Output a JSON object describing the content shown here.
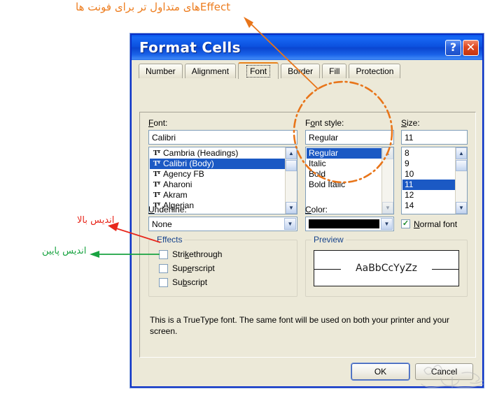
{
  "dialog": {
    "title": "Format Cells",
    "caption_buttons": [
      {
        "name": "help-button",
        "glyph": "?"
      },
      {
        "name": "close-button",
        "glyph": "✕"
      }
    ],
    "tabs": [
      {
        "label": "Number",
        "active": false
      },
      {
        "label": "Alignment",
        "active": false
      },
      {
        "label": "Font",
        "active": true
      },
      {
        "label": "Border",
        "active": false
      },
      {
        "label": "Fill",
        "active": false
      },
      {
        "label": "Protection",
        "active": false
      }
    ]
  },
  "font_column": {
    "label": "Font:",
    "value": "Calibri",
    "items": [
      {
        "label": "Cambria (Headings)",
        "truetype": true,
        "selected": false
      },
      {
        "label": "Calibri (Body)",
        "truetype": true,
        "selected": true
      },
      {
        "label": "Agency FB",
        "truetype": true,
        "selected": false
      },
      {
        "label": "Aharoni",
        "truetype": true,
        "selected": false
      },
      {
        "label": "Akram",
        "truetype": true,
        "selected": false
      },
      {
        "label": "Algerian",
        "truetype": true,
        "selected": false
      }
    ]
  },
  "style_column": {
    "label": "Font style:",
    "value": "Regular",
    "items": [
      {
        "label": "Regular",
        "selected": true
      },
      {
        "label": "Italic",
        "selected": false
      },
      {
        "label": "Bold",
        "selected": false
      },
      {
        "label": "Bold Italic",
        "selected": false
      }
    ]
  },
  "size_column": {
    "label": "Size:",
    "value": "11",
    "items": [
      {
        "label": "8",
        "selected": false
      },
      {
        "label": "9",
        "selected": false
      },
      {
        "label": "10",
        "selected": false
      },
      {
        "label": "11",
        "selected": true
      },
      {
        "label": "12",
        "selected": false
      },
      {
        "label": "14",
        "selected": false
      }
    ]
  },
  "underline": {
    "label": "Underline:",
    "value": "None"
  },
  "color": {
    "label": "Color:",
    "swatch_hex": "#000000",
    "normal_font_label": "Normal font",
    "normal_font_checked": true
  },
  "effects": {
    "title": "Effects",
    "items": [
      {
        "label": "Strikethrough",
        "checked": false
      },
      {
        "label": "Superscript",
        "checked": false
      },
      {
        "label": "Subscript",
        "checked": false
      }
    ]
  },
  "preview": {
    "title": "Preview",
    "sample_text": "AaBbCcYyZz"
  },
  "description": "This is a TrueType font.  The same font will be used on both your printer and your screen.",
  "footer": {
    "ok_label": "OK",
    "cancel_label": "Cancel"
  },
  "annotations": {
    "top": {
      "text": "Effectهای متداول تر برای فونت ها",
      "color": "#ED7D1F"
    },
    "superscript": {
      "text": "اندیس بالا",
      "color": "#E8271C"
    },
    "subscript": {
      "text": "اندیس پایین",
      "color": "#19A341"
    }
  }
}
